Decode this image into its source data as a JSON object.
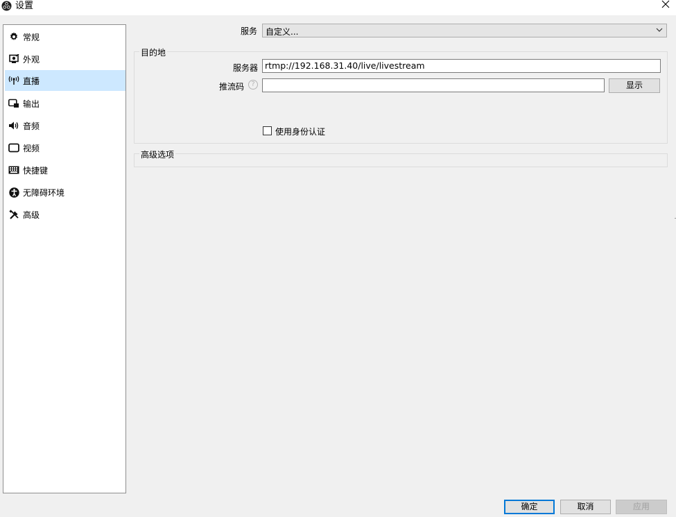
{
  "window": {
    "title": "设置",
    "app_icon": "obs-logo-icon",
    "close_icon": "close-icon"
  },
  "sidebar": {
    "items": [
      {
        "label": "常规",
        "icon": "gear-icon",
        "active": false
      },
      {
        "label": "外观",
        "icon": "appearance-icon",
        "active": false
      },
      {
        "label": "直播",
        "icon": "broadcast-icon",
        "active": true
      },
      {
        "label": "输出",
        "icon": "output-icon",
        "active": false
      },
      {
        "label": "音频",
        "icon": "speaker-icon",
        "active": false
      },
      {
        "label": "视频",
        "icon": "monitor-icon",
        "active": false
      },
      {
        "label": "快捷键",
        "icon": "keyboard-icon",
        "active": false
      },
      {
        "label": "无障碍环境",
        "icon": "accessibility-icon",
        "active": false
      },
      {
        "label": "高级",
        "icon": "tools-icon",
        "active": false
      }
    ]
  },
  "stream": {
    "service_label": "服务",
    "service_value": "自定义...",
    "destination": {
      "title": "目的地",
      "server_label": "服务器",
      "server_value": "rtmp://192.168.31.40/live/livestream",
      "stream_key_label": "推流码",
      "stream_key_value": "",
      "show_button": "显示",
      "auth_label": "使用身份认证",
      "auth_checked": false
    },
    "advanced_title": "高级选项"
  },
  "footer": {
    "ok": "确定",
    "cancel": "取消",
    "apply": "应用"
  },
  "colors": {
    "selection": "#cde8ff",
    "focus_border": "#0078d7",
    "background": "#f0f0f0"
  }
}
